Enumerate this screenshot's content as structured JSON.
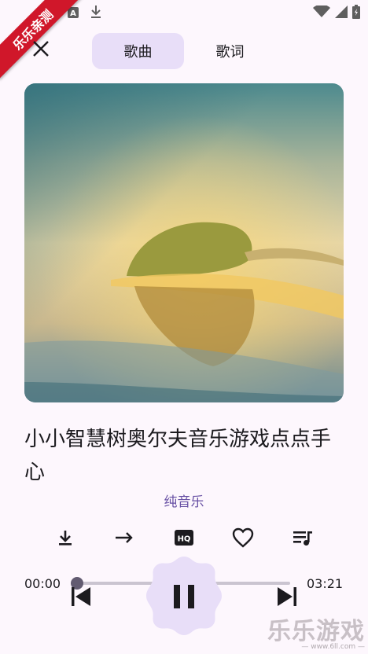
{
  "ribbon": {
    "label": "乐乐亲测"
  },
  "statusbar": {
    "left_icons": [
      "keyboard-a-icon",
      "download-icon"
    ],
    "right_icons": [
      "wifi-icon",
      "signal-icon",
      "battery-icon"
    ]
  },
  "tabs": [
    {
      "label": "歌曲",
      "active": true
    },
    {
      "label": "歌词",
      "active": false
    }
  ],
  "song": {
    "title": "小小智慧树奥尔夫音乐游戏点点手心",
    "artist": "纯音乐"
  },
  "actions": [
    "download-icon",
    "shuffle-arrow-icon",
    "hq-icon",
    "heart-icon",
    "playlist-icon"
  ],
  "player": {
    "current_time": "00:00",
    "total_time": "03:21",
    "progress": 0,
    "state": "playing"
  },
  "watermark": {
    "title": "乐乐游戏",
    "url": "— www.6ll.com —"
  },
  "colors": {
    "accent": "#6750a4",
    "tab_active_bg": "#e8def8",
    "background": "#fdf7fd"
  }
}
